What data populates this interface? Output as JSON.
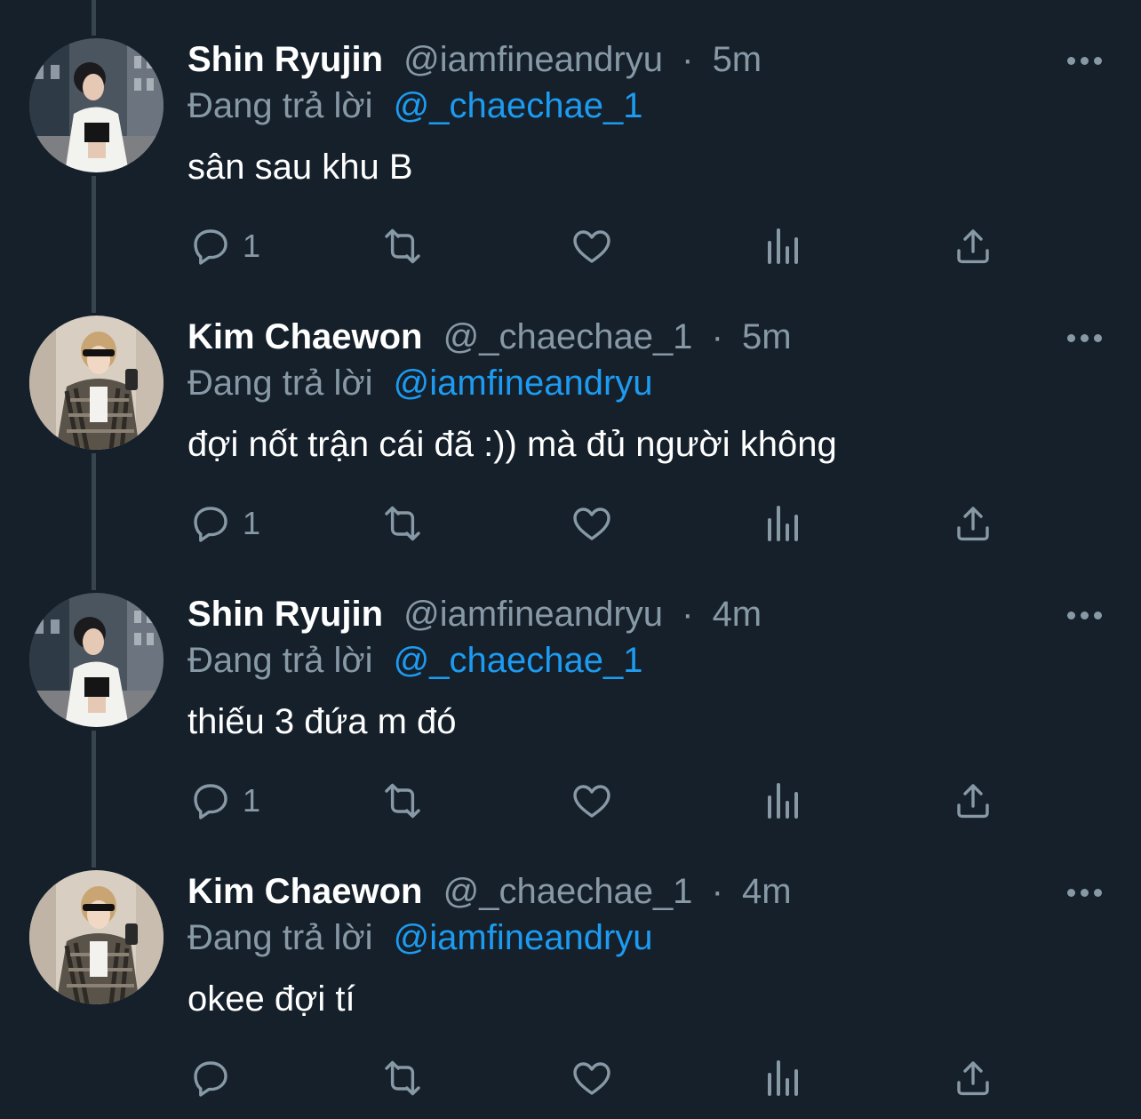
{
  "colors": {
    "background": "#15202b",
    "secondary_text": "#8899a6",
    "link": "#1d9bf0",
    "thread_line": "#38444d"
  },
  "tweets": [
    {
      "name": "Shin Ryujin",
      "handle": "@iamfineandryu",
      "separator": "·",
      "time": "5m",
      "reply_prefix": "Đang trả lời",
      "reply_to": "@_chaechae_1",
      "text": "sân sau khu B",
      "reply_count": "1",
      "avatar": "photo-avatar-street"
    },
    {
      "name": "Kim Chaewon",
      "handle": "@_chaechae_1",
      "separator": "·",
      "time": "5m",
      "reply_prefix": "Đang trả lời",
      "reply_to": "@iamfineandryu",
      "text": "đợi nốt trận cái đã :)) mà đủ người không",
      "reply_count": "1",
      "avatar": "photo-avatar-mirror"
    },
    {
      "name": "Shin Ryujin",
      "handle": "@iamfineandryu",
      "separator": "·",
      "time": "4m",
      "reply_prefix": "Đang trả lời",
      "reply_to": "@_chaechae_1",
      "text": "thiếu 3 đứa m đó",
      "reply_count": "1",
      "avatar": "photo-avatar-street"
    },
    {
      "name": "Kim Chaewon",
      "handle": "@_chaechae_1",
      "separator": "·",
      "time": "4m",
      "reply_prefix": "Đang trả lời",
      "reply_to": "@iamfineandryu",
      "text": "okee đợi tí",
      "reply_count": "",
      "avatar": "photo-avatar-mirror"
    }
  ],
  "icons": {
    "reply": "reply-icon",
    "retweet": "retweet-icon",
    "like": "like-icon",
    "views": "views-icon",
    "share": "share-icon",
    "more": "more-icon"
  }
}
